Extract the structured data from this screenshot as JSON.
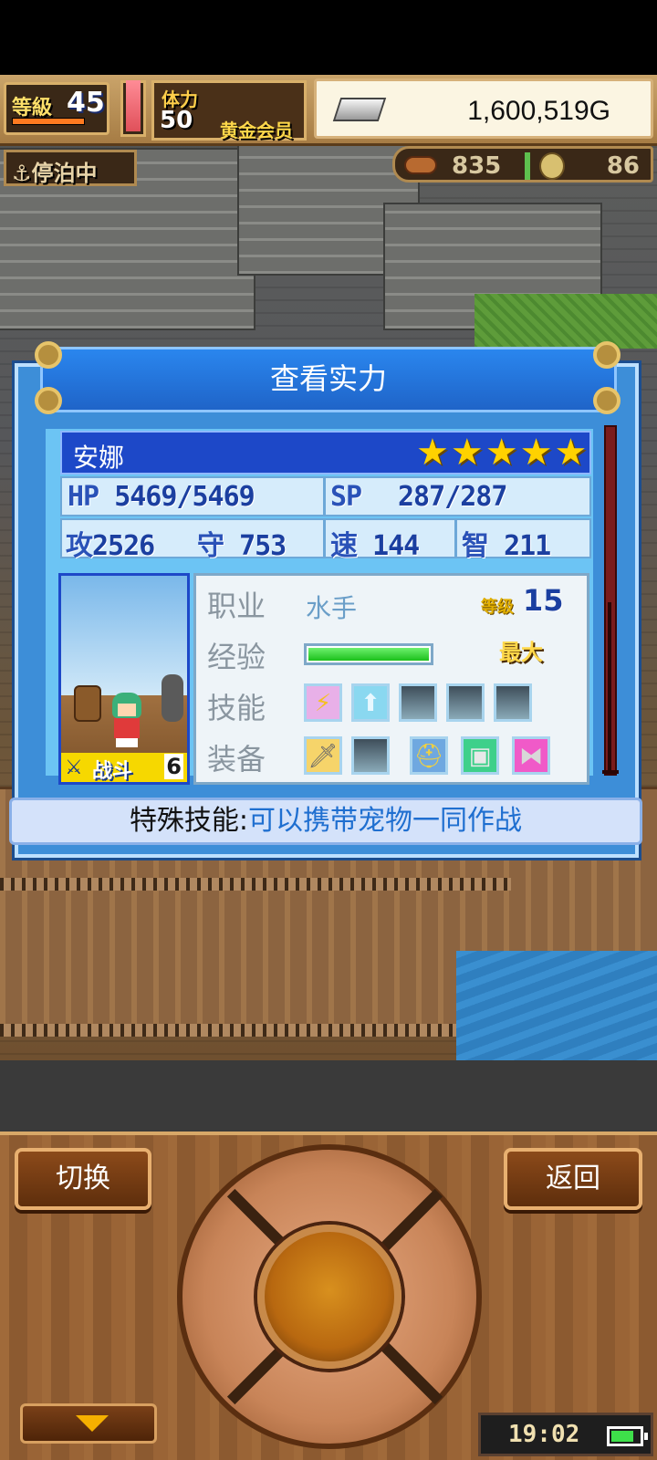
{
  "hud": {
    "level_label": "等級",
    "level_value": "45",
    "stamina_label": "体力",
    "stamina_value": "50",
    "membership": "黄金会员",
    "gold_value": "1,600,519G",
    "dock_status": "⚓停泊中",
    "food_value": "835",
    "gold_medal_value": "86"
  },
  "dialog": {
    "title": "查看实力",
    "character": {
      "name": "安娜",
      "stars": "★★★★★",
      "star_count": 5
    },
    "stats": {
      "hp_label": "HP",
      "hp_value": "5469/5469",
      "sp_label": "SP",
      "sp_value": "287/287",
      "atk_label": "攻",
      "atk_value": "2526",
      "def_label": "守",
      "def_value": "753",
      "spd_label": "速",
      "spd_value": "144",
      "int_label": "智",
      "int_value": "211"
    },
    "portrait_badge": {
      "type": "战斗",
      "number": "6"
    },
    "info": {
      "job_label": "职业",
      "job_value": "水手",
      "level_label": "等级",
      "level_value": "15",
      "exp_label": "经验",
      "exp_status": "最大",
      "exp_fraction": 1.0,
      "skill_label": "技能",
      "equip_label": "装备"
    },
    "special": {
      "label": "特殊技能:",
      "value": "可以携带宠物一同作战"
    }
  },
  "controls": {
    "switch_label": "切换",
    "back_label": "返回"
  },
  "status": {
    "time": "19:02"
  },
  "colors": {
    "dialog_blue": "#3d8ed8",
    "title_blue": "#1f64c8",
    "star_yellow": "#ffd200",
    "wood": "#8c5a30"
  },
  "icons": {
    "skill_1": "lightning-icon",
    "skill_2": "up-arrow-icon",
    "equip_1": "dagger-icon",
    "equip_3": "helmet-icon",
    "equip_4": "armor-icon",
    "equip_5": "accessory-icon"
  }
}
